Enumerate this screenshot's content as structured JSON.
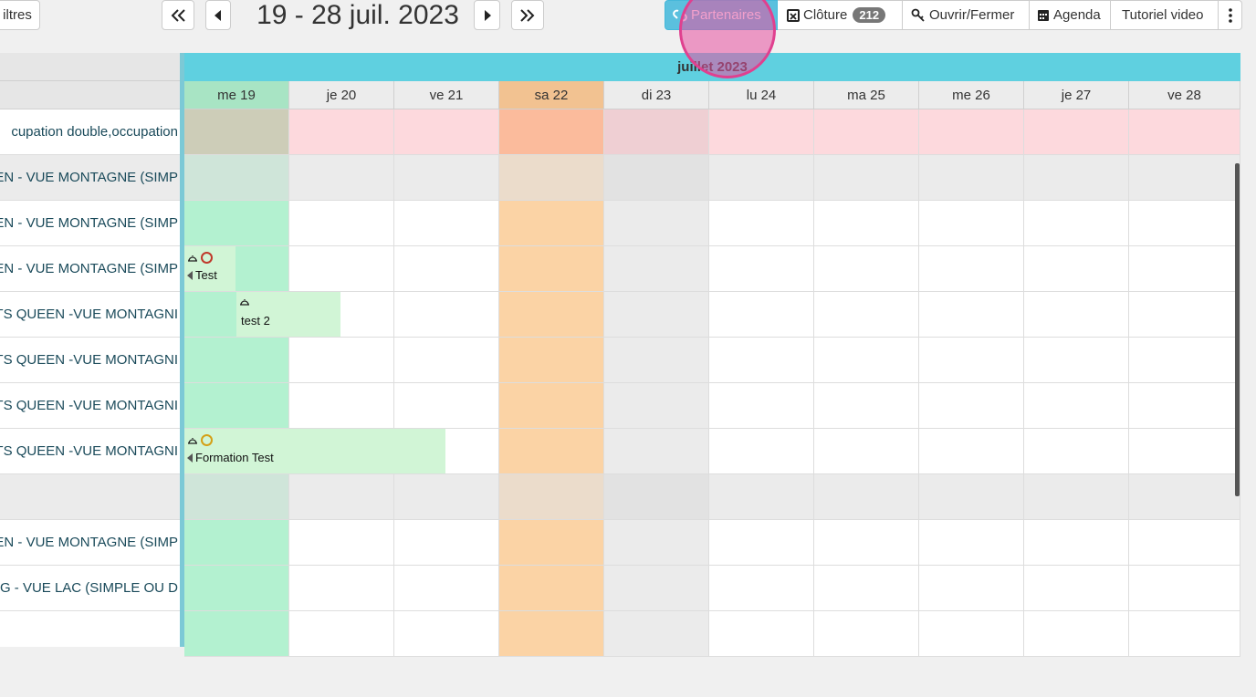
{
  "toolbar": {
    "filters_label": "iltres",
    "date_range": "19 - 28 juil. 2023",
    "buttons": {
      "partners": "Partenaires",
      "closure": "Clôture",
      "closure_count": "212",
      "open_close": "Ouvrir/Fermer",
      "agenda": "Agenda",
      "tutorial": "Tutoriel video"
    }
  },
  "calendar": {
    "month": "juillet 2023",
    "days": [
      "me 19",
      "je 20",
      "ve 21",
      "sa 22",
      "di 23",
      "lu 24",
      "ma 25",
      "me 26",
      "je 27",
      "ve 28"
    ],
    "today_index": 0,
    "saturday_index": 3,
    "sunday_index": 4
  },
  "rooms": [
    {
      "label": "cupation double,occupation",
      "type": "category-red"
    },
    {
      "label": "EEN - VUE MONTAGNE (SIMP",
      "type": "category-grey"
    },
    {
      "label": "EEN - VUE MONTAGNE (SIMP",
      "type": "room"
    },
    {
      "label": "EEN - VUE MONTAGNE (SIMP",
      "type": "room"
    },
    {
      "label": "ITS QUEEN -VUE MONTAGNI",
      "type": "room"
    },
    {
      "label": "ITS QUEEN -VUE MONTAGNI",
      "type": "room"
    },
    {
      "label": "ITS QUEEN -VUE MONTAGNI",
      "type": "room"
    },
    {
      "label": "ITS QUEEN -VUE MONTAGNI",
      "type": "room"
    },
    {
      "label": "",
      "type": "category-grey"
    },
    {
      "label": "EEN - VUE MONTAGNE (SIMP",
      "type": "room"
    },
    {
      "label": "NG - VUE LAC (SIMPLE OU D",
      "type": "room"
    },
    {
      "label": "",
      "type": "room"
    }
  ],
  "bookings": [
    {
      "name": "Test",
      "row": 3,
      "status_color": "#c0392b"
    },
    {
      "name": "test 2",
      "row": 4,
      "status_color": ""
    },
    {
      "name": "Formation Test",
      "row": 7,
      "status_color": "#d4a017"
    }
  ],
  "colors": {
    "partners_bg": "#5bc0de",
    "today": "#b3f1d0",
    "saturday": "#fbd3a5",
    "sunday": "#ebebeb",
    "booking": "#d1f5d6",
    "header_accent": "#5fd0e0"
  }
}
